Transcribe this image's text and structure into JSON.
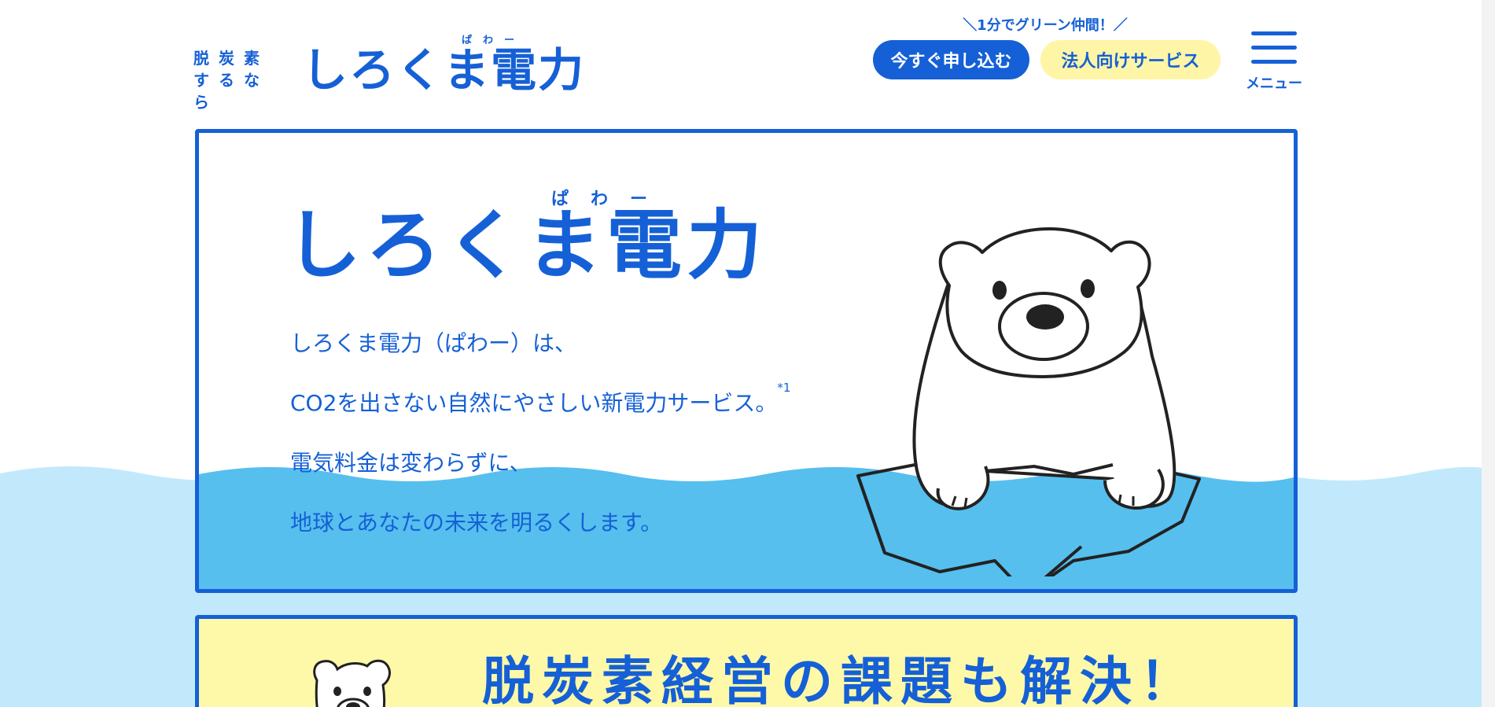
{
  "header": {
    "logo_small": "脱炭素 するなら",
    "logo_ruby": "ぱわー",
    "logo_main": "しろくま電力",
    "tagline": "＼1分でグリーン仲間！／",
    "apply_label": "今すぐ申し込む",
    "corporate_label": "法人向けサービス",
    "menu_label": "メニュー"
  },
  "hero": {
    "ruby": "ぱわー",
    "title": "しろくま電力",
    "lines": [
      "しろくま電力（ぱわー）は、",
      "CO2を出さない自然にやさしい新電力サービス。",
      "電気料金は変わらずに、",
      "地球とあなたの未来を明るくします。"
    ],
    "footnote_mark": "*1"
  },
  "card2": {
    "title": "脱炭素経営の課題も解決！"
  },
  "colors": {
    "brand_blue": "#1560d6",
    "water": "#56bfee",
    "water_light": "#c2e9fb",
    "yellow": "#fff5a6"
  },
  "icons": {
    "menu": "hamburger-icon",
    "mascot": "polar-bear-illustration"
  }
}
